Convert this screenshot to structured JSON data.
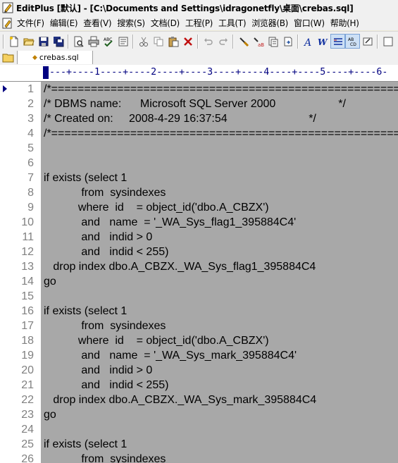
{
  "window": {
    "title": "EditPlus [默认] - [C:\\Documents and Settings\\idragonetfly\\桌面\\crebas.sql]"
  },
  "menu": {
    "items": [
      "文件(F)",
      "编辑(E)",
      "查看(V)",
      "搜索(S)",
      "文档(D)",
      "工程(P)",
      "工具(T)",
      "浏览器(B)",
      "窗口(W)",
      "帮助(H)"
    ]
  },
  "toolbar": {
    "buttons": [
      "new-file-icon",
      "open-folder-icon",
      "save-icon",
      "save-all-icon",
      "print-preview-icon",
      "print-icon",
      "spell-check-icon",
      "page-icon",
      "cut-icon",
      "copy-icon",
      "paste-icon",
      "delete-icon",
      "undo-icon",
      "redo-icon",
      "find-icon",
      "replace-icon",
      "clipboard-icon",
      "goto-icon",
      "font-icon",
      "word-wrap-icon",
      "line-number-icon",
      "ruler-icon",
      "settings-icon",
      "more-icon"
    ]
  },
  "tabs": {
    "active_file": "crebas.sql"
  },
  "ruler": {
    "text": "----+----1----+----2----+----3----+----4----+----5----+----6-"
  },
  "editor": {
    "lines": [
      {
        "n": "1",
        "text": "/*=============================================================="
      },
      {
        "n": "2",
        "text": "/* DBMS name:      Microsoft SQL Server 2000                    */"
      },
      {
        "n": "3",
        "text": "/* Created on:     2008-4-29 16:37:54                          */"
      },
      {
        "n": "4",
        "text": "/*=============================================================="
      },
      {
        "n": "5",
        "text": ""
      },
      {
        "n": "6",
        "text": ""
      },
      {
        "n": "7",
        "text": "if exists (select 1"
      },
      {
        "n": "8",
        "text": "            from  sysindexes"
      },
      {
        "n": "9",
        "text": "           where  id    = object_id('dbo.A_CBZX')"
      },
      {
        "n": "10",
        "text": "            and   name  = '_WA_Sys_flag1_395884C4'"
      },
      {
        "n": "11",
        "text": "            and   indid > 0"
      },
      {
        "n": "12",
        "text": "            and   indid < 255)"
      },
      {
        "n": "13",
        "text": "   drop index dbo.A_CBZX._WA_Sys_flag1_395884C4"
      },
      {
        "n": "14",
        "text": "go"
      },
      {
        "n": "15",
        "text": ""
      },
      {
        "n": "16",
        "text": "if exists (select 1"
      },
      {
        "n": "17",
        "text": "            from  sysindexes"
      },
      {
        "n": "18",
        "text": "           where  id    = object_id('dbo.A_CBZX')"
      },
      {
        "n": "19",
        "text": "            and   name  = '_WA_Sys_mark_395884C4'"
      },
      {
        "n": "20",
        "text": "            and   indid > 0"
      },
      {
        "n": "21",
        "text": "            and   indid < 255)"
      },
      {
        "n": "22",
        "text": "   drop index dbo.A_CBZX._WA_Sys_mark_395884C4"
      },
      {
        "n": "23",
        "text": "go"
      },
      {
        "n": "24",
        "text": ""
      },
      {
        "n": "25",
        "text": "if exists (select 1"
      },
      {
        "n": "26",
        "text": "            from  sysindexes"
      }
    ]
  }
}
